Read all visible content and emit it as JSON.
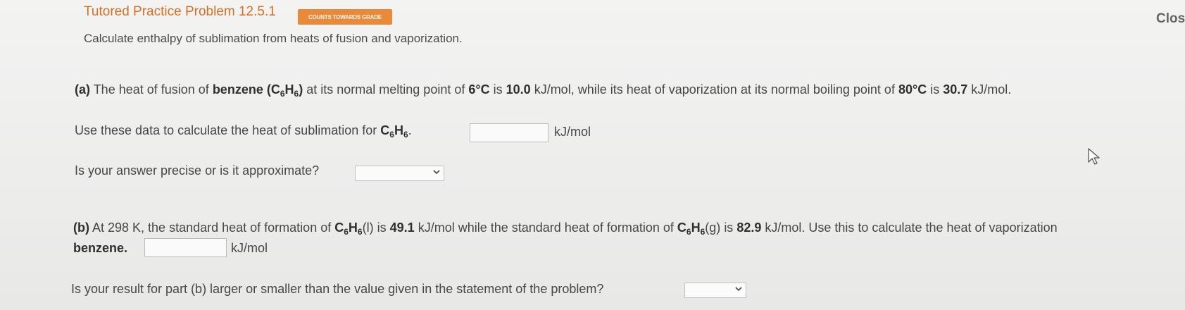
{
  "header": {
    "title": "Tutored Practice Problem 12.5.1",
    "badge": "COUNTS TOWARDS GRADE",
    "close_label": "Clos"
  },
  "description": "Calculate enthalpy of sublimation from heats of fusion and vaporization.",
  "part_a": {
    "label": "(a)",
    "text_1": "The heat of fusion of",
    "compound": "benzene",
    "formula_open": "(C",
    "sub_1": "6",
    "formula_h": "H",
    "sub_2": "6",
    "formula_close": ")",
    "text_2": "at its normal melting point of",
    "mp": "6°C",
    "text_3": "is",
    "fusion_value": "10.0",
    "text_4": "kJ/mol, while its heat of vaporization at its normal boiling point of",
    "bp": "80°C",
    "text_5": "is",
    "vap_value": "30.7",
    "text_6": "kJ/mol.",
    "q1_text": "Use these data to calculate the heat of sublimation for",
    "q1_formula_c": "C",
    "q1_sub_1": "6",
    "q1_formula_h": "H",
    "q1_sub_2": "6",
    "q1_end": ".",
    "q1_unit": "kJ/mol",
    "q1_value": "",
    "q2_text": "Is your answer precise or is it approximate?",
    "q2_selected": ""
  },
  "part_b": {
    "label": "(b)",
    "text_1": "At 298 K, the standard heat of formation of",
    "f1_c": "C",
    "f1_sub_1": "6",
    "f1_h": "H",
    "f1_sub_2": "6",
    "f1_state": "(l)",
    "text_2": "is",
    "liq_value": "49.1",
    "text_3": "kJ/mol while the standard heat of formation of",
    "f2_c": "C",
    "f2_sub_1": "6",
    "f2_h": "H",
    "f2_sub_2": "6",
    "f2_state": "(g)",
    "text_4": "is",
    "gas_value": "82.9",
    "text_5": "kJ/mol. Use this to calculate the heat of vaporization",
    "line2_bold": "benzene.",
    "unit": "kJ/mol",
    "answer_value": "",
    "q2_text": "Is your result for part (b) larger or smaller than the value given in the statement of the problem?",
    "q2_selected": ""
  },
  "colors": {
    "title": "#d47025",
    "badge_bg": "#e9893a"
  }
}
